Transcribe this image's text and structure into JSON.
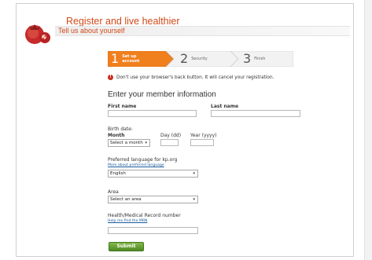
{
  "header": {
    "title": "Register and live healthier",
    "subtitle": "Tell us about yourself"
  },
  "steps": [
    {
      "number": "1",
      "label_line1": "Set up",
      "label_line2": "account"
    },
    {
      "number": "2",
      "label_line1": "Security",
      "label_line2": ""
    },
    {
      "number": "3",
      "label_line1": "Finish",
      "label_line2": ""
    }
  ],
  "warning": {
    "icon": "!",
    "text": "Don't use your browser's back button. It will cancel your registration."
  },
  "form": {
    "section_title": "Enter your member information",
    "first_name_label": "First name",
    "last_name_label": "Last name",
    "birth_date_label": "Birth date:",
    "month_label": "Month",
    "month_value": "Select a month",
    "day_label": "Day (dd)",
    "year_label": "Year (yyyy)",
    "language_label": "Preferred language for kp.org",
    "language_link": "More about preferred language",
    "language_value": "English",
    "area_label": "Area",
    "area_value": "Select an area",
    "mrn_label": "Health/Medical Record number",
    "mrn_link": "Help me find the MRN",
    "submit_label": "Submit"
  },
  "colors": {
    "accent": "#d2491a",
    "step_active": "#f07f1e",
    "submit": "#5f9a2f",
    "link": "#1a5a9c",
    "warning": "#cc2b1b"
  }
}
